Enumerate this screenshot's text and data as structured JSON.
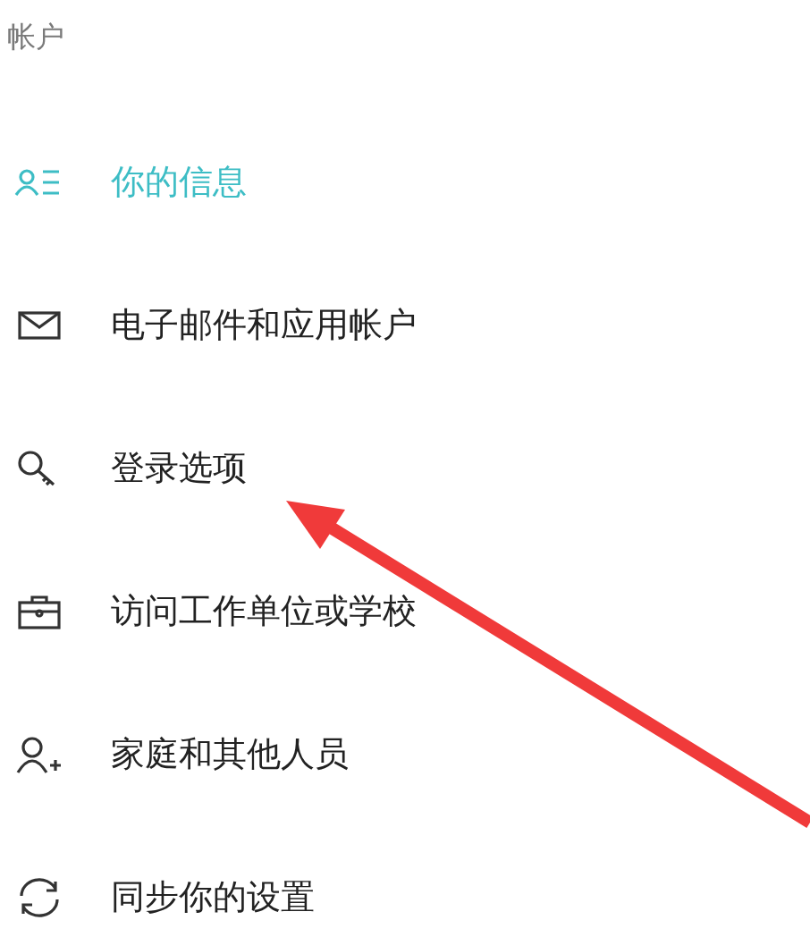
{
  "header": "帐户",
  "items": [
    {
      "label": "你的信息",
      "kind": "info",
      "selected": true
    },
    {
      "label": "电子邮件和应用帐户",
      "kind": "mail",
      "selected": false
    },
    {
      "label": "登录选项",
      "kind": "key",
      "selected": false
    },
    {
      "label": "访问工作单位或学校",
      "kind": "briefcase",
      "selected": false
    },
    {
      "label": "家庭和其他人员",
      "kind": "person-add",
      "selected": false
    },
    {
      "label": "同步你的设置",
      "kind": "sync",
      "selected": false
    }
  ]
}
